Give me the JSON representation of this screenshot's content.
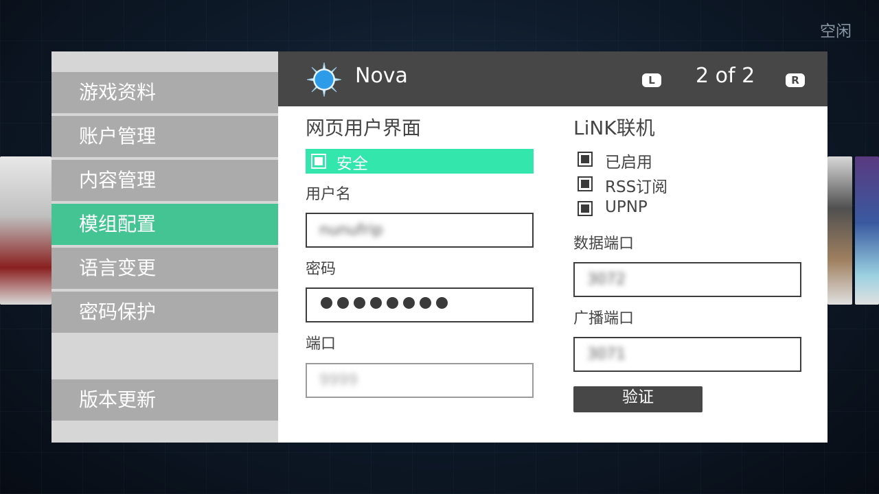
{
  "status_text": "空闲",
  "game": {
    "title": "Nova",
    "page_indicator": "2 of 2",
    "left_shoulder": "L",
    "right_shoulder": "R"
  },
  "sidebar": {
    "items": [
      {
        "label": "游戏资料",
        "active": false
      },
      {
        "label": "账户管理",
        "active": false
      },
      {
        "label": "内容管理",
        "active": false
      },
      {
        "label": "模组配置",
        "active": true
      },
      {
        "label": "语言变更",
        "active": false
      },
      {
        "label": "密码保护",
        "active": false
      }
    ],
    "update_label": "版本更新"
  },
  "web_ui": {
    "heading": "网页用户界面",
    "secure_label": "安全",
    "username_label": "用户名",
    "username_value": "nunufrip",
    "password_label": "密码",
    "password_value": "●●●●●●●●",
    "port_label": "端口",
    "port_value": "9999"
  },
  "link": {
    "heading": "LiNK联机",
    "options": [
      {
        "label": "已启用",
        "checked": true
      },
      {
        "label": "RSS订阅",
        "checked": true
      },
      {
        "label": "UPNP",
        "checked": true
      }
    ],
    "data_port_label": "数据端口",
    "data_port_value": "3072",
    "broadcast_port_label": "广播端口",
    "broadcast_port_value": "3071",
    "verify_label": "验证"
  },
  "colors": {
    "active": "#44c493",
    "secure_highlight": "#33e6ab",
    "header": "#474747"
  }
}
